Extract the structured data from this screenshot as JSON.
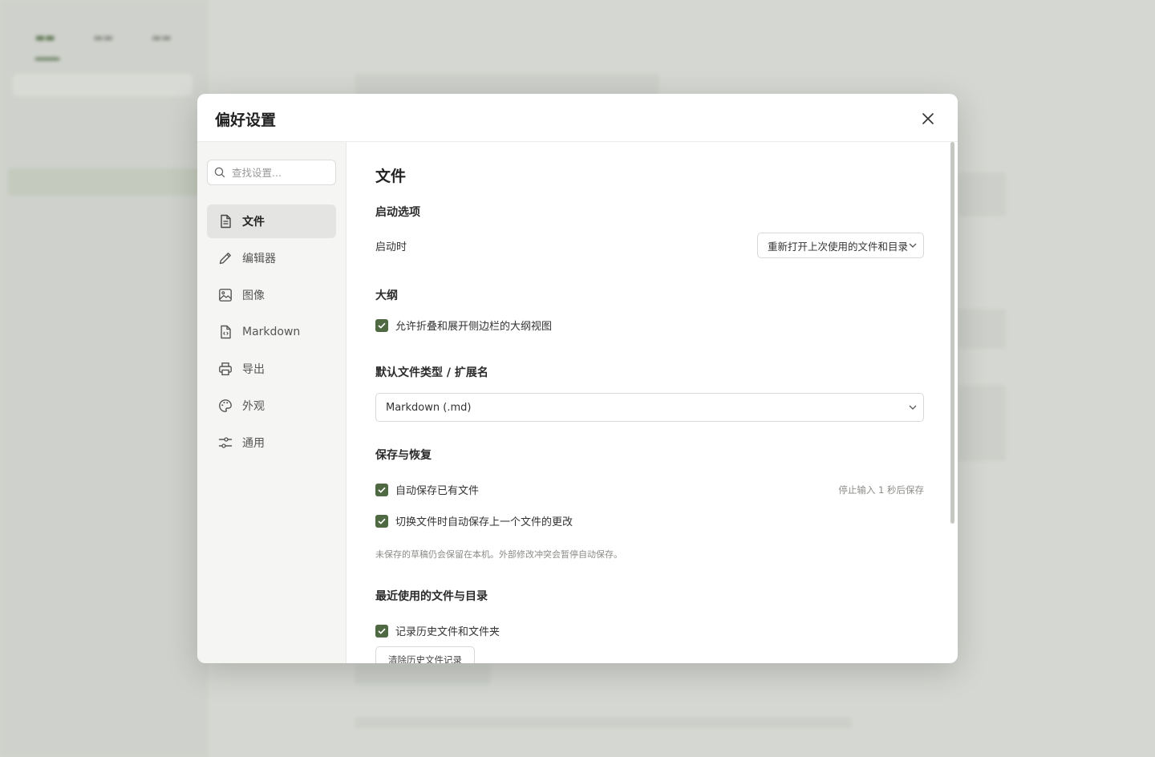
{
  "modal": {
    "title": "偏好设置",
    "search_placeholder": "查找设置...",
    "nav": [
      {
        "label": "文件",
        "icon": "file-text-icon",
        "active": true
      },
      {
        "label": "编辑器",
        "icon": "pencil-icon",
        "active": false
      },
      {
        "label": "图像",
        "icon": "image-icon",
        "active": false
      },
      {
        "label": "Markdown",
        "icon": "markdown-file-icon",
        "active": false
      },
      {
        "label": "导出",
        "icon": "printer-icon",
        "active": false
      },
      {
        "label": "外观",
        "icon": "palette-icon",
        "active": false
      },
      {
        "label": "通用",
        "icon": "sliders-icon",
        "active": false
      }
    ]
  },
  "content": {
    "title": "文件",
    "startup": {
      "heading": "启动选项",
      "label": "启动时",
      "value": "重新打开上次使用的文件和目录"
    },
    "outline": {
      "heading": "大纲",
      "checkbox": "允许折叠和展开侧边栏的大纲视图",
      "checked": true
    },
    "default_type": {
      "heading": "默认文件类型 / 扩展名",
      "value": "Markdown (.md)"
    },
    "save": {
      "heading": "保存与恢复",
      "autosave": "自动保存已有文件",
      "autosave_hint": "停止输入 1 秒后保存",
      "switch_save": "切换文件时自动保存上一个文件的更改",
      "note": "未保存的草稿仍会保留在本机。外部修改冲突会暂停自动保存。"
    },
    "recent": {
      "heading": "最近使用的文件与目录",
      "checkbox": "记录历史文件和文件夹",
      "clear_button": "清除历史文件记录"
    }
  },
  "colors": {
    "accent": "#4f6a43",
    "modal_bg": "#ffffff",
    "nav_bg": "#f5f6f4",
    "overlay_bg": "#d3d5d0"
  }
}
